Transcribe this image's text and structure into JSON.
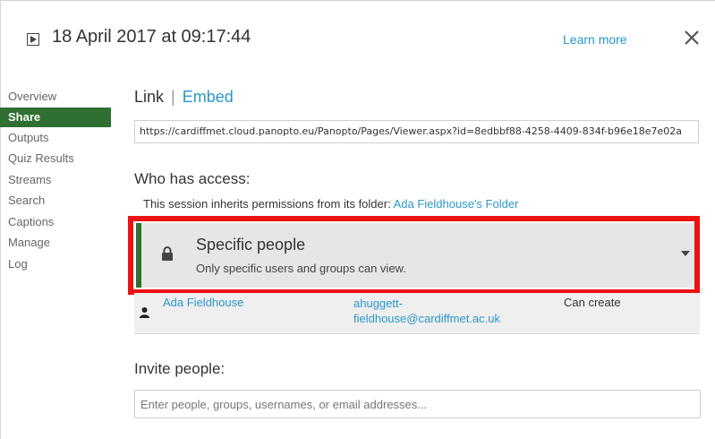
{
  "header": {
    "title": "18 April 2017 at 09:17:44",
    "learn_more": "Learn more",
    "close_glyph": "✕"
  },
  "sidebar": {
    "items": [
      {
        "label": "Overview",
        "active": false
      },
      {
        "label": "Share",
        "active": true
      },
      {
        "label": "Outputs",
        "active": false
      },
      {
        "label": "Quiz Results",
        "active": false
      },
      {
        "label": "Streams",
        "active": false
      },
      {
        "label": "Search",
        "active": false
      },
      {
        "label": "Captions",
        "active": false
      },
      {
        "label": "Manage",
        "active": false
      },
      {
        "label": "Log",
        "active": false
      }
    ]
  },
  "share": {
    "tab_link": "Link",
    "tab_separator": "|",
    "tab_embed": "Embed",
    "url": "https://cardiffmet.cloud.panopto.eu/Panopto/Pages/Viewer.aspx?id=8edbbf88-4258-4409-834f-b96e18e7e02a",
    "who_has_access": "Who has access:",
    "inherit_text": "This session inherits permissions from its folder: ",
    "inherit_folder": "Ada Fieldhouse's Folder",
    "access_title": "Specific people",
    "access_desc": "Only specific users and groups can view.",
    "permissions": [
      {
        "name": "Ada Fieldhouse",
        "email_line1": "ahuggett-",
        "email_line2": "fieldhouse@cardiffmet.ac.uk",
        "role": "Can create"
      }
    ],
    "invite_heading": "Invite people:",
    "invite_placeholder": "Enter people, groups, usernames, or email addresses..."
  },
  "colors": {
    "accent_green": "#2f6f32",
    "link_blue": "#2a97c8",
    "highlight_red": "#ee1111"
  },
  "icons": {
    "play": "play-icon",
    "close": "close-icon",
    "lock": "lock-icon",
    "caret": "caret-down-icon",
    "user": "user-icon"
  }
}
